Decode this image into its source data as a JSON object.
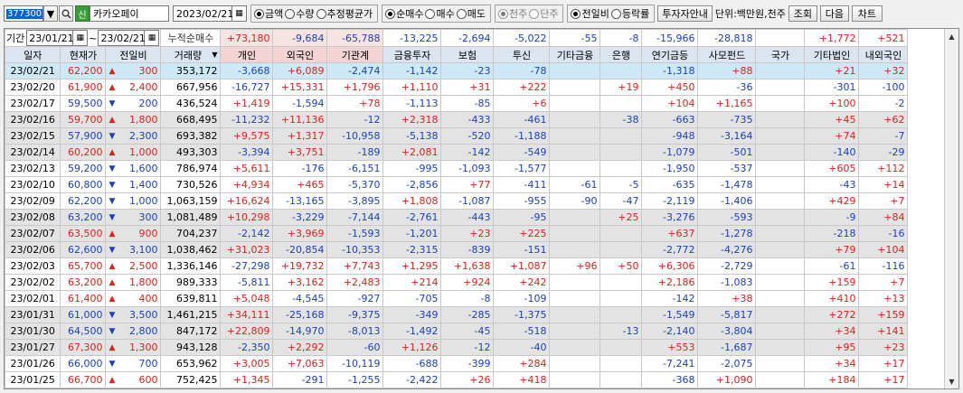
{
  "toolbar": {
    "code": "377300",
    "sin_label": "신",
    "name": "카카오페이",
    "date": "2023/02/21",
    "radio_group1": [
      {
        "label": "금액",
        "on": true
      },
      {
        "label": "수량",
        "on": false
      },
      {
        "label": "추정평균가",
        "on": false
      }
    ],
    "radio_group2": [
      {
        "label": "순매수",
        "on": true
      },
      {
        "label": "매수",
        "on": false
      },
      {
        "label": "매도",
        "on": false
      }
    ],
    "radio_group3": [
      {
        "label": "천주",
        "on": true
      },
      {
        "label": "단주",
        "on": false
      }
    ],
    "radio_group4": [
      {
        "label": "전일비",
        "on": true
      },
      {
        "label": "등락률",
        "on": false
      }
    ],
    "investor_info_btn": "투자자안내",
    "unit_label": "단위:백만원,천주",
    "query_btn": "조회",
    "next_btn": "다음",
    "chart_btn": "차트"
  },
  "period": {
    "label": "기간",
    "from": "23/01/21",
    "to": "23/02/21",
    "cumulative_label": "누적순매수"
  },
  "summary": [
    "+73,180",
    "-9,684",
    "-65,788",
    "-13,225",
    "-2,694",
    "-5,022",
    "-55",
    "-8",
    "-15,966",
    "-28,818",
    "",
    "+1,772",
    "+521"
  ],
  "headers": [
    "일자",
    "현재가",
    "전일비",
    "거래량",
    "개인",
    "외국인",
    "기관계",
    "금융투자",
    "보험",
    "투신",
    "기타금융",
    "은행",
    "연기금등",
    "사모펀드",
    "국가",
    "기타법인",
    "내외국인"
  ],
  "rows": [
    {
      "date": "23/02/21",
      "price": "62,200",
      "dir": "up",
      "chg": "300",
      "vol": "353,172",
      "v": [
        "-3,668",
        "+6,089",
        "-2,474",
        "-1,142",
        "-23",
        "-78",
        "",
        "",
        "-1,318",
        "+88",
        "",
        "+21",
        "+32"
      ]
    },
    {
      "date": "23/02/20",
      "price": "61,900",
      "dir": "up",
      "chg": "2,400",
      "vol": "667,956",
      "v": [
        "-16,727",
        "+15,331",
        "+1,796",
        "+1,110",
        "+31",
        "+222",
        "",
        "+19",
        "+450",
        "-36",
        "",
        "-301",
        "-100"
      ]
    },
    {
      "date": "23/02/17",
      "price": "59,500",
      "dir": "dn",
      "chg": "200",
      "vol": "436,524",
      "v": [
        "+1,419",
        "-1,594",
        "+78",
        "-1,113",
        "-85",
        "+6",
        "",
        "",
        "+104",
        "+1,165",
        "",
        "+100",
        "-2"
      ]
    },
    {
      "date": "23/02/16",
      "price": "59,700",
      "dir": "up",
      "chg": "1,800",
      "vol": "668,495",
      "v": [
        "-11,232",
        "+11,136",
        "-12",
        "+2,318",
        "-433",
        "-461",
        "",
        "-38",
        "-663",
        "-735",
        "",
        "+45",
        "+62"
      ]
    },
    {
      "date": "23/02/15",
      "price": "57,900",
      "dir": "dn",
      "chg": "2,300",
      "vol": "693,382",
      "v": [
        "+9,575",
        "+1,317",
        "-10,958",
        "-5,138",
        "-520",
        "-1,188",
        "",
        "",
        "-948",
        "-3,164",
        "",
        "+74",
        "-7"
      ]
    },
    {
      "date": "23/02/14",
      "price": "60,200",
      "dir": "up",
      "chg": "1,000",
      "vol": "493,303",
      "v": [
        "-3,394",
        "+3,751",
        "-189",
        "+2,081",
        "-142",
        "-549",
        "",
        "",
        "-1,079",
        "-501",
        "",
        "-140",
        "-29"
      ]
    },
    {
      "date": "23/02/13",
      "price": "59,200",
      "dir": "dn",
      "chg": "1,600",
      "vol": "786,974",
      "v": [
        "+5,611",
        "-176",
        "-6,151",
        "-995",
        "-1,093",
        "-1,577",
        "",
        "",
        "-1,950",
        "-537",
        "",
        "+605",
        "+112"
      ]
    },
    {
      "date": "23/02/10",
      "price": "60,800",
      "dir": "dn",
      "chg": "1,400",
      "vol": "730,526",
      "v": [
        "+4,934",
        "+465",
        "-5,370",
        "-2,856",
        "+77",
        "-411",
        "-61",
        "-5",
        "-635",
        "-1,478",
        "",
        "-43",
        "+14"
      ]
    },
    {
      "date": "23/02/09",
      "price": "62,200",
      "dir": "dn",
      "chg": "1,000",
      "vol": "1,063,159",
      "v": [
        "+16,624",
        "-13,165",
        "-3,895",
        "+1,808",
        "-1,087",
        "-955",
        "-90",
        "-47",
        "-2,119",
        "-1,406",
        "",
        "+429",
        "+7"
      ]
    },
    {
      "date": "23/02/08",
      "price": "63,200",
      "dir": "dn",
      "chg": "300",
      "vol": "1,081,489",
      "v": [
        "+10,298",
        "-3,229",
        "-7,144",
        "-2,761",
        "-443",
        "-95",
        "",
        "+25",
        "-3,276",
        "-593",
        "",
        "-9",
        "+84"
      ]
    },
    {
      "date": "23/02/07",
      "price": "63,500",
      "dir": "up",
      "chg": "900",
      "vol": "704,237",
      "v": [
        "-2,142",
        "+3,969",
        "-1,593",
        "-1,201",
        "+23",
        "+225",
        "",
        "",
        "+637",
        "-1,278",
        "",
        "-218",
        "-16"
      ]
    },
    {
      "date": "23/02/06",
      "price": "62,600",
      "dir": "dn",
      "chg": "3,100",
      "vol": "1,038,462",
      "v": [
        "+31,023",
        "-20,854",
        "-10,353",
        "-2,315",
        "-839",
        "-151",
        "",
        "",
        "-2,772",
        "-4,276",
        "",
        "+79",
        "+104"
      ]
    },
    {
      "date": "23/02/03",
      "price": "65,700",
      "dir": "up",
      "chg": "2,500",
      "vol": "1,336,146",
      "v": [
        "-27,298",
        "+19,732",
        "+7,743",
        "+1,295",
        "+1,638",
        "+1,087",
        "+96",
        "+50",
        "+6,306",
        "-2,729",
        "",
        "-61",
        "-116"
      ]
    },
    {
      "date": "23/02/02",
      "price": "63,200",
      "dir": "up",
      "chg": "1,800",
      "vol": "989,333",
      "v": [
        "-5,811",
        "+3,162",
        "+2,483",
        "+214",
        "+924",
        "+242",
        "",
        "",
        "+2,186",
        "-1,083",
        "",
        "+159",
        "+7"
      ]
    },
    {
      "date": "23/02/01",
      "price": "61,400",
      "dir": "up",
      "chg": "400",
      "vol": "639,811",
      "v": [
        "+5,048",
        "-4,545",
        "-927",
        "-705",
        "-8",
        "-109",
        "",
        "",
        "-142",
        "+38",
        "",
        "+410",
        "+13"
      ]
    },
    {
      "date": "23/01/31",
      "price": "61,000",
      "dir": "dn",
      "chg": "3,500",
      "vol": "1,461,215",
      "v": [
        "+34,111",
        "-25,168",
        "-9,375",
        "-349",
        "-285",
        "-1,375",
        "",
        "",
        "-1,549",
        "-5,817",
        "",
        "+272",
        "+159"
      ]
    },
    {
      "date": "23/01/30",
      "price": "64,500",
      "dir": "dn",
      "chg": "2,800",
      "vol": "847,172",
      "v": [
        "+22,809",
        "-14,970",
        "-8,013",
        "-1,492",
        "-45",
        "-518",
        "",
        "-13",
        "-2,140",
        "-3,804",
        "",
        "+34",
        "+141"
      ]
    },
    {
      "date": "23/01/27",
      "price": "67,300",
      "dir": "up",
      "chg": "1,300",
      "vol": "943,128",
      "v": [
        "-2,350",
        "+2,292",
        "-60",
        "+1,126",
        "-12",
        "-40",
        "",
        "",
        "+553",
        "-1,687",
        "",
        "+95",
        "+23"
      ]
    },
    {
      "date": "23/01/26",
      "price": "66,000",
      "dir": "dn",
      "chg": "700",
      "vol": "653,962",
      "v": [
        "+3,005",
        "+7,063",
        "-10,119",
        "-688",
        "-399",
        "+284",
        "",
        "",
        "-7,241",
        "-2,075",
        "",
        "+34",
        "+17"
      ]
    },
    {
      "date": "23/01/25",
      "price": "66,700",
      "dir": "up",
      "chg": "600",
      "vol": "752,425",
      "v": [
        "+1,345",
        "-291",
        "-1,255",
        "-2,422",
        "+26",
        "+418",
        "",
        "",
        "-368",
        "+1,090",
        "",
        "+184",
        "+17"
      ]
    }
  ],
  "icons": {
    "dropdown": "chevron-down-icon",
    "search": "search-icon",
    "calendar": "calendar-icon",
    "sort": "sort-down-icon",
    "scroll_up": "scroll-up-icon",
    "scroll_down": "scroll-down-icon"
  }
}
